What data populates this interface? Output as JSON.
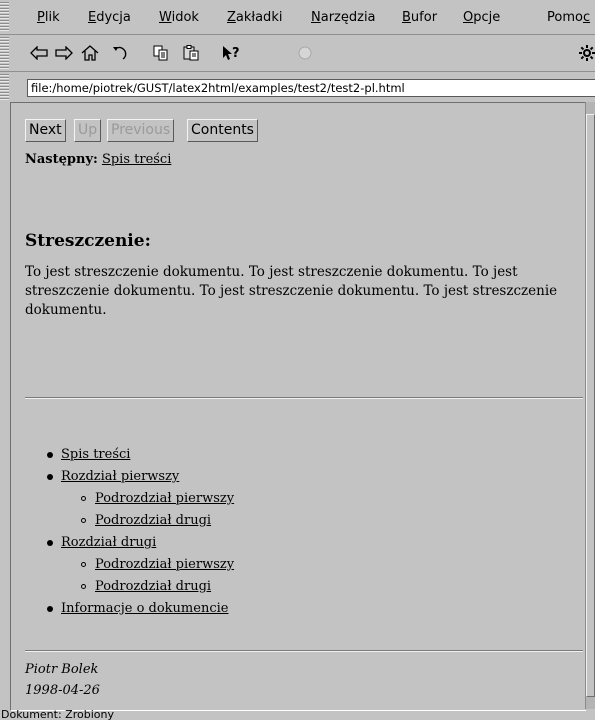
{
  "menu": [
    "Plik",
    "Edycja",
    "Widok",
    "Zakładki",
    "Narzędzia",
    "Bufor",
    "Opcje",
    "Pomoc"
  ],
  "menu_underline": [
    "P",
    "E",
    "W",
    "Z",
    "N",
    "B",
    "O",
    "c"
  ],
  "toolbar": {
    "icons": [
      "arrow-left-icon",
      "arrow-right-icon",
      "home-icon",
      "reload-icon",
      "copy-icon",
      "paste-icon",
      "help-pointer-icon",
      "stop-icon",
      "settings-icon"
    ]
  },
  "location": {
    "url": "file:/home/piotrek/GUST/latex2html/examples/test2/test2-pl.html"
  },
  "nav": {
    "next": "Next",
    "up": "Up",
    "previous": "Previous",
    "contents": "Contents",
    "next_prefix": "Następny:",
    "next_link": "Spis treści"
  },
  "abstract": {
    "title": "Streszczenie:",
    "text": "To jest streszczenie dokumentu. To jest streszczenie dokumentu. To jest streszczenie dokumentu. To jest streszczenie dokumentu. To jest streszczenie dokumentu."
  },
  "toc": [
    {
      "label": "Spis treści",
      "level": 0
    },
    {
      "label": "Rozdział pierwszy",
      "level": 0
    },
    {
      "label": "Podrozdział pierwszy",
      "level": 1
    },
    {
      "label": "Podrozdział drugi",
      "level": 1
    },
    {
      "label": "Rozdział drugi",
      "level": 0
    },
    {
      "label": "Podrozdział pierwszy",
      "level": 1
    },
    {
      "label": "Podrozdział drugi",
      "level": 1
    },
    {
      "label": "Informacje o dokumencie",
      "level": 0
    }
  ],
  "footer": {
    "author": "Piotr Bolek",
    "date": "1998-04-26"
  },
  "status": "Dokument: Zrobiony"
}
